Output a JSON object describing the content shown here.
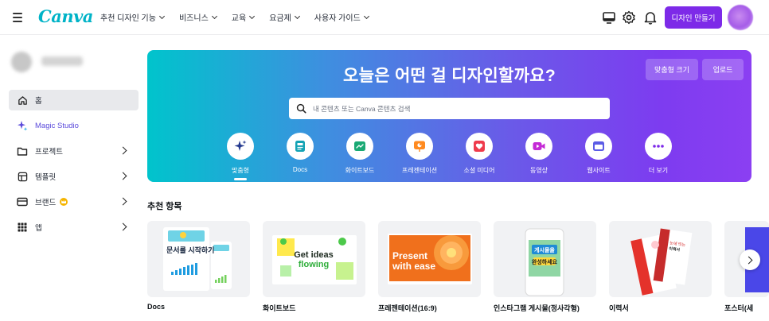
{
  "topbar": {
    "logo": "Canva",
    "nav": [
      {
        "label": "추천 디자인 기능"
      },
      {
        "label": "비즈니스"
      },
      {
        "label": "교육"
      },
      {
        "label": "요금제"
      },
      {
        "label": "사용자 가이드"
      }
    ],
    "create_button": "디자인 만들기",
    "icons": [
      "desktop-icon",
      "gear-icon",
      "bell-icon"
    ]
  },
  "sidebar": {
    "items": [
      {
        "label": "홈",
        "icon": "home-icon",
        "active": true
      },
      {
        "label": "Magic Studio",
        "icon": "sparkle-icon"
      },
      {
        "label": "프로젝트",
        "icon": "folder-icon"
      },
      {
        "label": "템플릿",
        "icon": "template-icon"
      },
      {
        "label": "브랜드",
        "icon": "brand-icon",
        "badge": "crown-icon"
      },
      {
        "label": "앱",
        "icon": "apps-grid-icon"
      }
    ]
  },
  "hero": {
    "title": "오늘은 어떤 걸 디자인할까요?",
    "custom_size_button": "맞춤형 크기",
    "upload_button": "업로드",
    "search_placeholder": "내 콘텐츠 또는 Canva 콘텐츠 검색",
    "categories": [
      {
        "label": "맞춤형",
        "icon": "sparkles-icon",
        "color": "#253a8f"
      },
      {
        "label": "Docs",
        "icon": "docs-icon",
        "color": "#13a3b5"
      },
      {
        "label": "화이트보드",
        "icon": "whiteboard-icon",
        "color": "#19a974"
      },
      {
        "label": "프레젠테이션",
        "icon": "presentation-icon",
        "color": "#ff8a1f"
      },
      {
        "label": "소셜 미디어",
        "icon": "heart-icon",
        "color": "#ef3b4c"
      },
      {
        "label": "동영상",
        "icon": "video-icon",
        "color": "#c42ad6"
      },
      {
        "label": "웹사이트",
        "icon": "website-icon",
        "color": "#5b5ce6"
      },
      {
        "label": "더 보기",
        "icon": "more-icon",
        "color": "#7d2ae8"
      }
    ]
  },
  "recommended": {
    "title": "추천 항목",
    "cards": [
      {
        "label": "Docs",
        "thumb_text": "문서를 시작하기"
      },
      {
        "label": "화이트보드",
        "thumb_text": "Get ideas flowing"
      },
      {
        "label": "프레젠테이션(16:9)",
        "thumb_text": "Present with ease"
      },
      {
        "label": "인스타그램 게시물(정사각형)",
        "thumb_text": "게시물을 완성하세요"
      },
      {
        "label": "이력서",
        "thumb_text": "눈에 띄는 이력서"
      },
      {
        "label": "포스터(세"
      }
    ]
  }
}
